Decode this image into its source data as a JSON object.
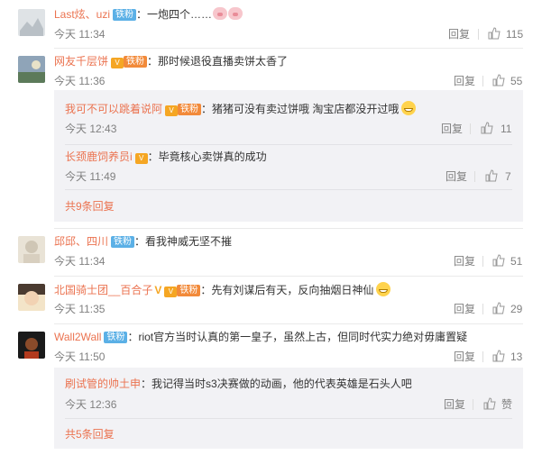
{
  "actions": {
    "reply": "回复"
  },
  "comments": [
    {
      "name": "Last炫、uzi",
      "badge": "铁粉",
      "text": "：一炮四个……",
      "time": "今天 11:34",
      "likes": "115"
    },
    {
      "name": "网友千层饼",
      "badge": "铁粉",
      "text": "：那时候退役直播卖饼太香了",
      "time": "今天 11:36",
      "likes": "55",
      "replies": [
        {
          "name": "我可不可以跳着说阿",
          "badge": "铁粉",
          "text": "：猪猪可没有卖过饼哦  淘宝店都没开过哦",
          "time": "今天 12:43",
          "likes": "11"
        },
        {
          "name": "长颈鹿饲养员i",
          "text": "：毕竟核心卖饼真的成功",
          "time": "今天 11:49",
          "likes": "7"
        }
      ],
      "more": "共9条回复"
    },
    {
      "name": "邱邱、四川",
      "badge": "铁粉",
      "text": "：看我神威无坚不摧",
      "time": "今天 11:34",
      "likes": "51"
    },
    {
      "name": "北国骑士团__百合子",
      "badge": "铁粉",
      "text": "：先有刘谋后有天，反向抽烟日神仙",
      "time": "今天 11:35",
      "likes": "29"
    },
    {
      "name": "Wall2Wall",
      "badge": "铁粉",
      "text": "：riot官方当时认真的第一皇子，虽然上古，但同时代实力绝对毋庸置疑",
      "time": "今天 11:50",
      "likes": "13",
      "replies": [
        {
          "name": "刷试管的帅土申",
          "text": "：我记得当时s3决赛做的动画，他的代表英雄是石头人吧",
          "time": "今天 12:36",
          "likes": "赞"
        }
      ],
      "more": "共5条回复"
    }
  ],
  "colors": {
    "name": "#eb7350",
    "badge": "#5bb0e6",
    "panel": "#f2f2f5"
  }
}
